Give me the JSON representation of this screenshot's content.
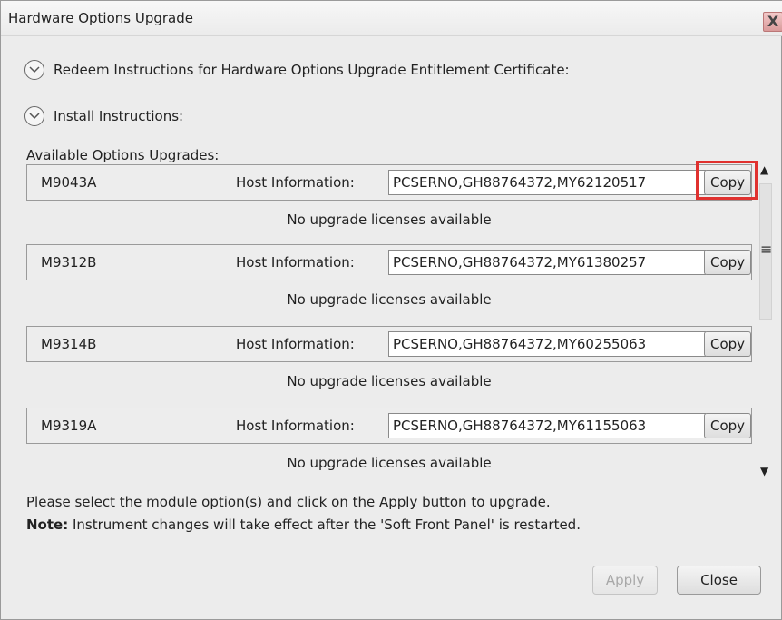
{
  "window": {
    "title": "Hardware Options Upgrade",
    "close_glyph": "X"
  },
  "sections": {
    "redeem_label": "Redeem Instructions for Hardware Options Upgrade Entitlement Certificate:",
    "install_label": "Install Instructions:"
  },
  "options": {
    "header": "Available Options Upgrades:",
    "host_label": "Host Information:",
    "copy_label": "Copy",
    "no_license_text": "No upgrade licenses available",
    "modules": [
      {
        "name": "M9043A",
        "host": "PCSERNO,GH88764372,MY62120517"
      },
      {
        "name": "M9312B",
        "host": "PCSERNO,GH88764372,MY61380257"
      },
      {
        "name": "M9314B",
        "host": "PCSERNO,GH88764372,MY60255063"
      },
      {
        "name": "M9319A",
        "host": "PCSERNO,GH88764372,MY61155063"
      }
    ]
  },
  "footer": {
    "instruction": "Please select the module option(s) and click on the Apply button to upgrade.",
    "note_label": "Note:",
    "note_text": " Instrument changes will take effect after the 'Soft Front Panel' is restarted."
  },
  "buttons": {
    "apply": "Apply",
    "close": "Close"
  },
  "icons": {
    "section_toggle": "chevron-down-circle-icon",
    "scroll_up": "scroll-up-arrow-icon",
    "scroll_down": "scroll-down-arrow-icon"
  },
  "colors": {
    "highlight": "#e0312f",
    "close_button": "#d99a9a"
  }
}
